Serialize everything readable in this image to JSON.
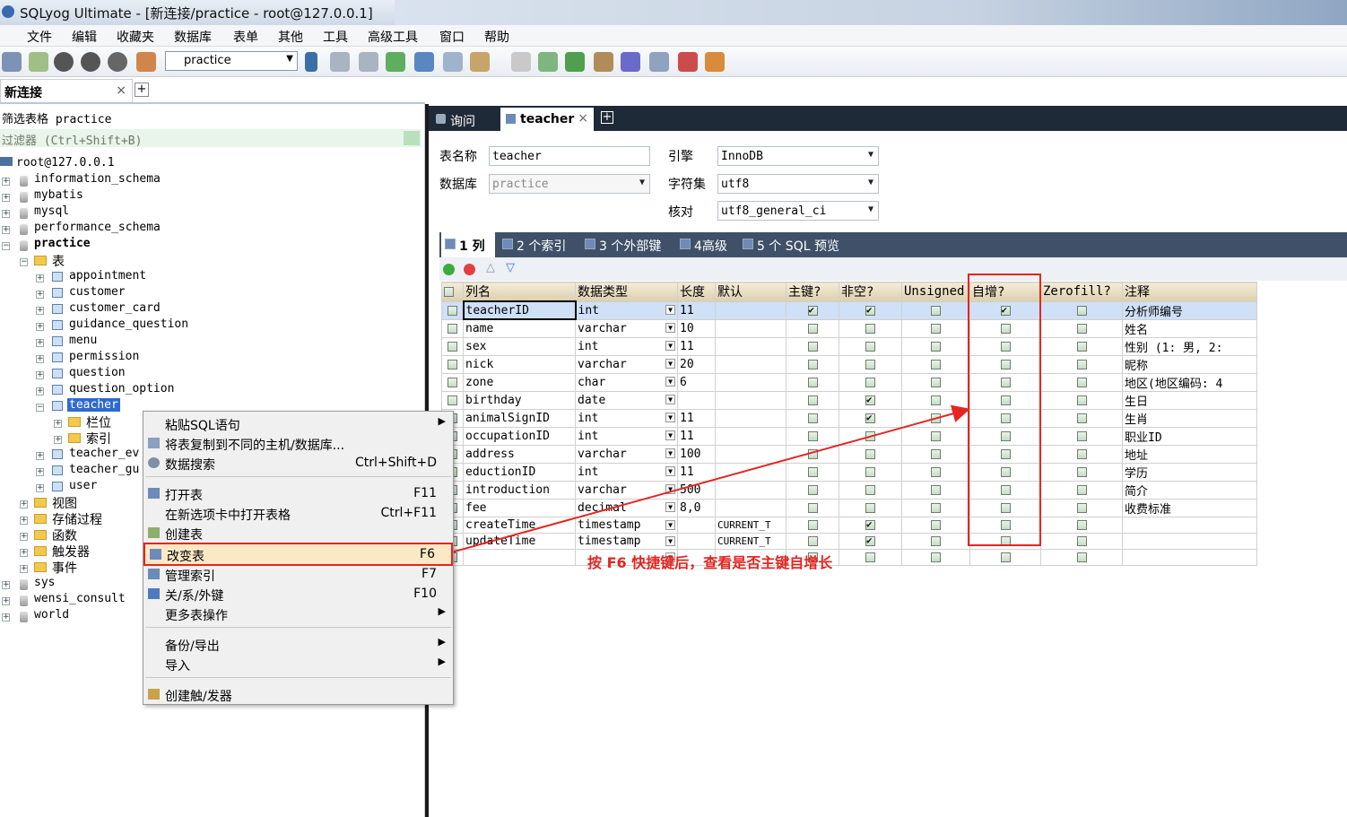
{
  "window": {
    "title": "SQLyog Ultimate - [新连接/practice - root@127.0.0.1]"
  },
  "menubar": [
    "文件",
    "编辑",
    "收藏夹",
    "数据库",
    "表单",
    "其他",
    "工具",
    "高级工具",
    "窗口",
    "帮助"
  ],
  "toolbar": {
    "db_selector": "practice"
  },
  "connection_tab": {
    "label": "新连接",
    "close": "×",
    "add": "+"
  },
  "left": {
    "filter_label": "筛选表格 practice",
    "filter_placeholder": "过滤器 (Ctrl+Shift+B)",
    "root": "root@127.0.0.1",
    "dbs": [
      "information_schema",
      "mybatis",
      "mysql",
      "performance_schema",
      "practice"
    ],
    "tables_folder": "表",
    "tables": [
      "appointment",
      "customer",
      "customer_card",
      "guidance_question",
      "menu",
      "permission",
      "question",
      "question_option",
      "teacher"
    ],
    "teacher_children": [
      "栏位",
      "索引"
    ],
    "tables_after": [
      "teacher_ev",
      "teacher_gu",
      "user"
    ],
    "folders": [
      "视图",
      "存储过程",
      "函数",
      "触发器",
      "事件"
    ],
    "other_dbs": [
      "sys",
      "wensi_consult",
      "world"
    ]
  },
  "right_tabs": {
    "query": "询问",
    "teacher": "teacher",
    "close": "×",
    "add": "+"
  },
  "form": {
    "table_name_label": "表名称",
    "table_name": "teacher",
    "database_label": "数据库",
    "database": "practice",
    "engine_label": "引擎",
    "engine": "InnoDB",
    "charset_label": "字符集",
    "charset": "utf8",
    "collation_label": "核对",
    "collation": "utf8_general_ci"
  },
  "subtabs": [
    "1 列",
    "2 个索引",
    "3 个外部键",
    "4高级",
    "5 个 SQL 预览"
  ],
  "grid": {
    "headers": [
      "列名",
      "数据类型",
      "长度",
      "默认",
      "主键?",
      "非空?",
      "Unsigned",
      "自增?",
      "Zerofill?",
      "注释"
    ],
    "rows": [
      {
        "name": "teacherID",
        "type": "int",
        "len": "11",
        "def": "",
        "pk": true,
        "nn": true,
        "un": false,
        "ai": true,
        "zf": false,
        "comment": "分析师编号"
      },
      {
        "name": "name",
        "type": "varchar",
        "len": "10",
        "def": "",
        "pk": false,
        "nn": false,
        "un": false,
        "ai": false,
        "zf": false,
        "comment": "姓名"
      },
      {
        "name": "sex",
        "type": "int",
        "len": "11",
        "def": "",
        "pk": false,
        "nn": false,
        "un": false,
        "ai": false,
        "zf": false,
        "comment": "性别 (1: 男, 2: "
      },
      {
        "name": "nick",
        "type": "varchar",
        "len": "20",
        "def": "",
        "pk": false,
        "nn": false,
        "un": false,
        "ai": false,
        "zf": false,
        "comment": "昵称"
      },
      {
        "name": "zone",
        "type": "char",
        "len": "6",
        "def": "",
        "pk": false,
        "nn": false,
        "un": false,
        "ai": false,
        "zf": false,
        "comment": "地区(地区编码: 4"
      },
      {
        "name": "birthday",
        "type": "date",
        "len": "",
        "def": "",
        "pk": false,
        "nn": true,
        "un": false,
        "ai": false,
        "zf": false,
        "comment": "生日"
      },
      {
        "name": "animalSignID",
        "type": "int",
        "len": "11",
        "def": "",
        "pk": false,
        "nn": true,
        "un": false,
        "ai": false,
        "zf": false,
        "comment": "生肖"
      },
      {
        "name": "occupationID",
        "type": "int",
        "len": "11",
        "def": "",
        "pk": false,
        "nn": false,
        "un": false,
        "ai": false,
        "zf": false,
        "comment": "职业ID"
      },
      {
        "name": "address",
        "type": "varchar",
        "len": "100",
        "def": "",
        "pk": false,
        "nn": false,
        "un": false,
        "ai": false,
        "zf": false,
        "comment": "地址"
      },
      {
        "name": "eductionID",
        "type": "int",
        "len": "11",
        "def": "",
        "pk": false,
        "nn": false,
        "un": false,
        "ai": false,
        "zf": false,
        "comment": "学历"
      },
      {
        "name": "introduction",
        "type": "varchar",
        "len": "500",
        "def": "",
        "pk": false,
        "nn": false,
        "un": false,
        "ai": false,
        "zf": false,
        "comment": "简介"
      },
      {
        "name": "fee",
        "type": "decimal",
        "len": "8,0",
        "def": "",
        "pk": false,
        "nn": false,
        "un": false,
        "ai": false,
        "zf": false,
        "comment": "收费标准"
      },
      {
        "name": "createTime",
        "type": "timestamp",
        "len": "",
        "def": "CURRENT_T",
        "pk": false,
        "nn": true,
        "un": false,
        "ai": false,
        "zf": false,
        "comment": ""
      },
      {
        "name": "updateTime",
        "type": "timestamp",
        "len": "",
        "def": "CURRENT_T",
        "pk": false,
        "nn": true,
        "un": false,
        "ai": false,
        "zf": false,
        "comment": ""
      },
      {
        "name": "",
        "type": "",
        "len": "",
        "def": "",
        "pk": false,
        "nn": false,
        "un": false,
        "ai": false,
        "zf": false,
        "comment": ""
      }
    ]
  },
  "annotation": "按 F6 快捷键后，查看是否主键自增长",
  "context_menu": [
    {
      "label": "粘贴SQL语句",
      "key": "",
      "sub": true
    },
    {
      "label": "将表复制到不同的主机/数据库...",
      "key": "",
      "sub": false
    },
    {
      "label": "数据搜索",
      "key": "Ctrl+Shift+D",
      "sub": false
    },
    {
      "label": "打开表",
      "key": "F11",
      "sub": false
    },
    {
      "label": "在新选项卡中打开表格",
      "key": "Ctrl+F11",
      "sub": false
    },
    {
      "label": "创建表",
      "key": "",
      "sub": false
    },
    {
      "label": "改变表",
      "key": "F6",
      "sub": false
    },
    {
      "label": "管理索引",
      "key": "F7",
      "sub": false
    },
    {
      "label": "关/系/外键",
      "key": "F10",
      "sub": false
    },
    {
      "label": "更多表操作",
      "key": "",
      "sub": true
    },
    {
      "label": "备份/导出",
      "key": "",
      "sub": true
    },
    {
      "label": "导入",
      "key": "",
      "sub": true
    },
    {
      "label": "创建触/发器",
      "key": "",
      "sub": false
    }
  ],
  "colors": {
    "highlight": "#e42520",
    "selection": "#2d6ad0"
  }
}
